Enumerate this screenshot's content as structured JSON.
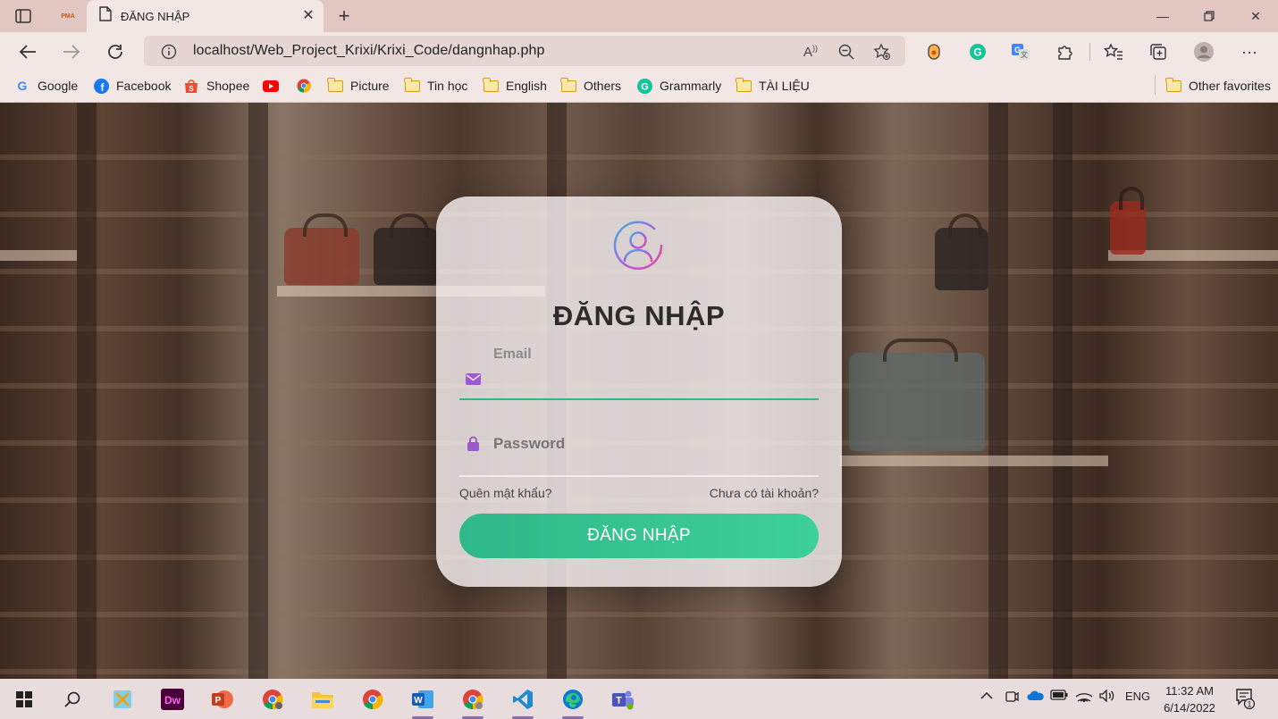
{
  "browser": {
    "tab_title": "ĐĂNG NHẬP",
    "pinned_tab_label": "PMA",
    "url": "localhost/Web_Project_Krixi/Krixi_Code/dangnhap.php"
  },
  "bookmarks": [
    {
      "label": "Google",
      "icon": "google-icon"
    },
    {
      "label": "Facebook",
      "icon": "facebook-icon"
    },
    {
      "label": "Shopee",
      "icon": "shopee-icon"
    },
    {
      "label": "",
      "icon": "youtube-icon"
    },
    {
      "label": "",
      "icon": "chrome-web-icon"
    },
    {
      "label": "Picture",
      "icon": "folder-icon"
    },
    {
      "label": "Tin học",
      "icon": "folder-icon"
    },
    {
      "label": "English",
      "icon": "folder-icon"
    },
    {
      "label": "Others",
      "icon": "folder-icon"
    },
    {
      "label": "Grammarly",
      "icon": "grammarly-icon"
    },
    {
      "label": "TÀI LIỆU",
      "icon": "folder-icon"
    }
  ],
  "other_favorites": "Other favorites",
  "login": {
    "title": "ĐĂNG NHẬP",
    "email_label": "Email",
    "email_value": "",
    "password_placeholder": "Password",
    "forgot": "Quên mật khẩu?",
    "register": "Chưa có tài khoản?",
    "button": "ĐĂNG NHẬP"
  },
  "taskbar": {
    "language": "ENG",
    "time": "11:32 AM",
    "date": "6/14/2022",
    "notifications": "1"
  },
  "colors": {
    "accent_green": "#2fb88a",
    "icon_purple": "#9b59d0"
  }
}
